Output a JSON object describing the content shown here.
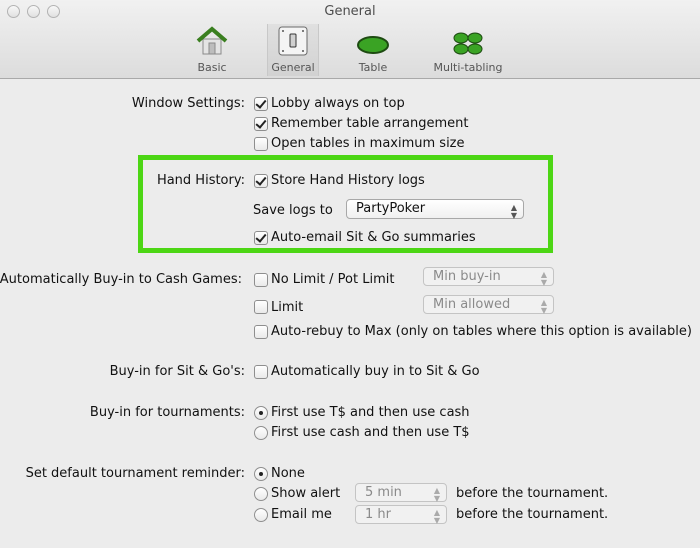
{
  "window": {
    "title": "General"
  },
  "toolbar": {
    "items": [
      {
        "label": "Basic",
        "icon": "house-icon",
        "selected": false
      },
      {
        "label": "General",
        "icon": "switch-icon",
        "selected": true
      },
      {
        "label": "Table",
        "icon": "poker-table-icon",
        "selected": false
      },
      {
        "label": "Multi-tabling",
        "icon": "multi-table-icon",
        "selected": false
      }
    ]
  },
  "window_settings": {
    "label": "Window Settings:",
    "options": [
      {
        "label": "Lobby always on top",
        "checked": true
      },
      {
        "label": "Remember table arrangement",
        "checked": true
      },
      {
        "label": "Open tables in maximum size",
        "checked": false
      }
    ]
  },
  "hand_history": {
    "label": "Hand History:",
    "store_logs": {
      "label": "Store Hand History logs",
      "checked": true
    },
    "save_logs_label": "Save logs to",
    "save_logs_value": "PartyPoker",
    "auto_email": {
      "label": "Auto-email Sit & Go summaries",
      "checked": true
    },
    "highlight_color": "#4cd614"
  },
  "cash_games": {
    "label": "Automatically Buy-in to Cash Games:",
    "no_limit": {
      "label": "No Limit / Pot Limit",
      "checked": false,
      "popup": "Min buy-in"
    },
    "limit": {
      "label": "Limit",
      "checked": false,
      "popup": "Min allowed"
    },
    "auto_rebuy": {
      "label": "Auto-rebuy to Max (only on tables where this option is available)",
      "checked": false
    }
  },
  "sit_and_go": {
    "label": "Buy-in for Sit & Go's:",
    "option": {
      "label": "Automatically buy in to Sit & Go",
      "checked": false
    }
  },
  "tournaments": {
    "label": "Buy-in for tournaments:",
    "options": [
      {
        "label": "First use T$ and then use cash",
        "selected": true
      },
      {
        "label": "First use cash and then use T$",
        "selected": false
      }
    ]
  },
  "reminder": {
    "label": "Set default tournament reminder:",
    "none": {
      "label": "None",
      "selected": true
    },
    "show_alert": {
      "label": "Show alert",
      "selected": false,
      "popup": "5 min",
      "suffix": "before the tournament."
    },
    "email_me": {
      "label": "Email me",
      "selected": false,
      "popup": "1 hr",
      "suffix": "before the tournament."
    }
  }
}
